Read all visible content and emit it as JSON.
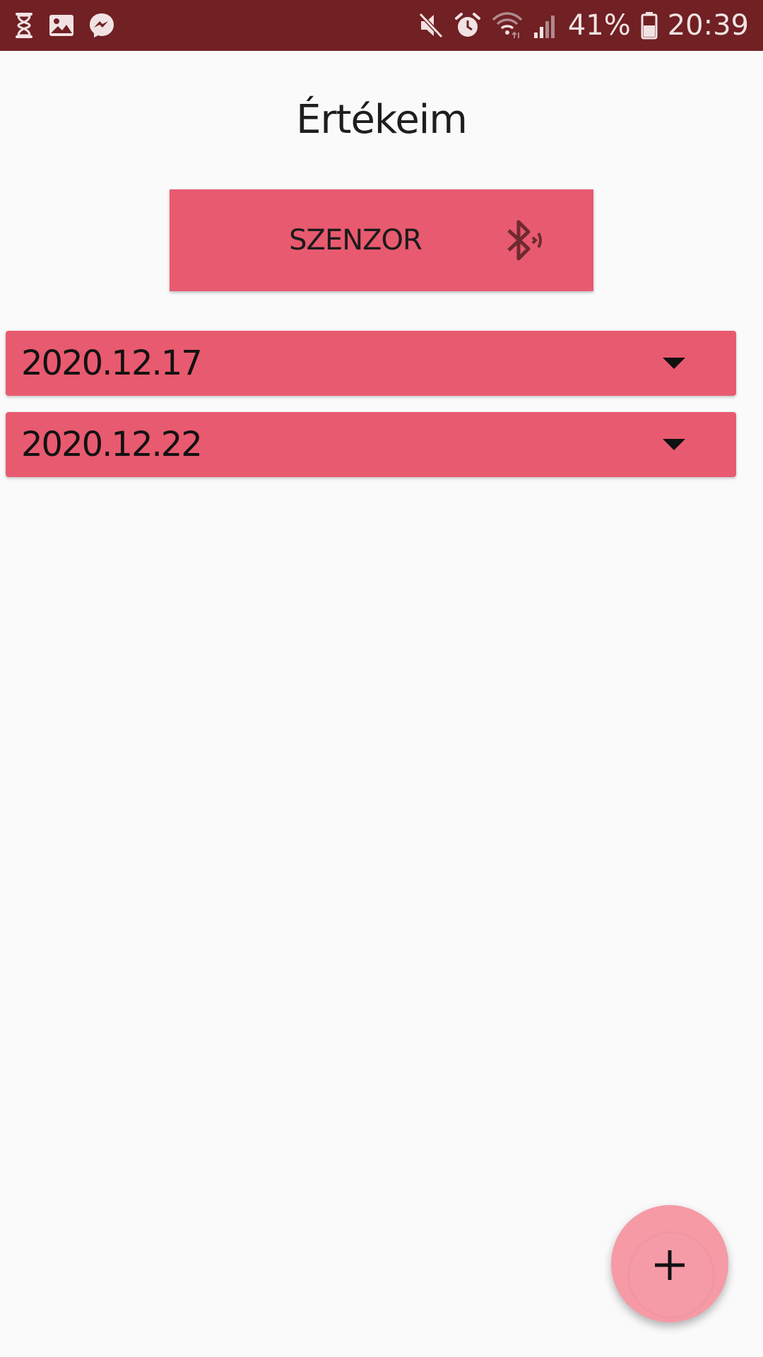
{
  "status_bar": {
    "battery_percent": "41%",
    "time": "20:39",
    "left_icons": [
      "hourglass-icon",
      "gallery-icon",
      "messenger-icon"
    ],
    "right_icons": [
      "mute-icon",
      "alarm-icon",
      "wifi-icon",
      "signal-icon",
      "battery-icon"
    ]
  },
  "page": {
    "title": "Értékeim"
  },
  "sensor_button": {
    "label": "SZENZOR",
    "icon": "bluetooth-audio-icon"
  },
  "date_list": [
    {
      "date": "2020.12.17",
      "icon": "dropdown-arrow-icon"
    },
    {
      "date": "2020.12.22",
      "icon": "dropdown-arrow-icon"
    }
  ],
  "fab": {
    "icon": "plus-icon"
  },
  "colors": {
    "status_bar_bg": "#712024",
    "accent": "#e85a6f",
    "fab_bg": "#f69aa6",
    "background": "#fafafa"
  }
}
